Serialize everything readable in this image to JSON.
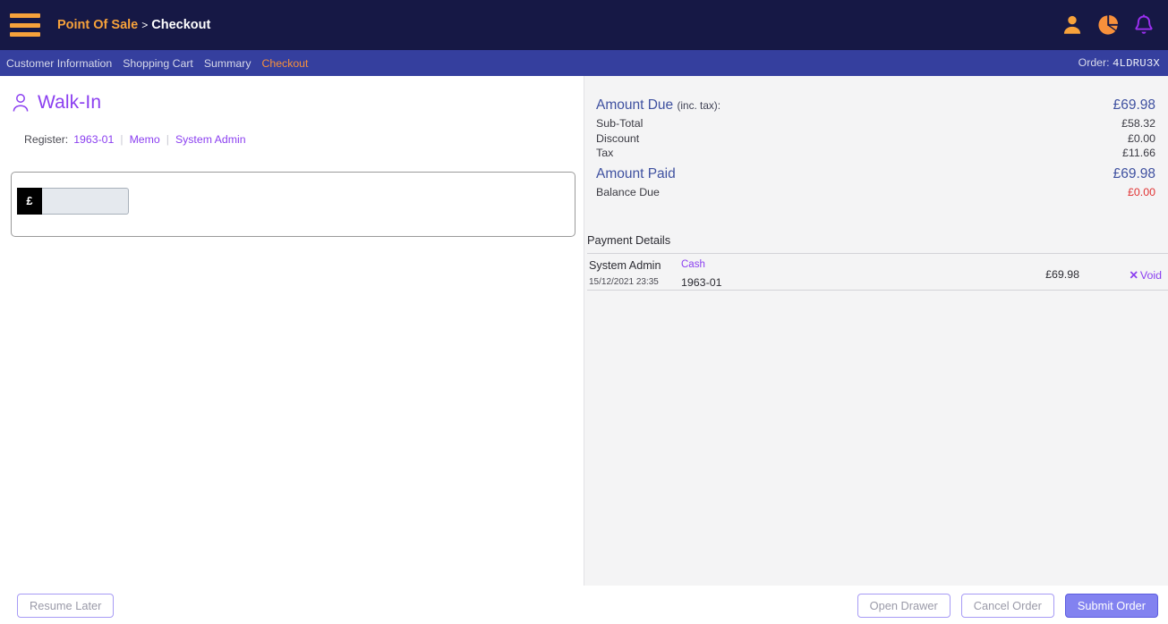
{
  "header": {
    "menu_icon": "hamburger-icon",
    "breadcrumb_root": "Point Of Sale",
    "breadcrumb_separator": ">",
    "breadcrumb_leaf": "Checkout",
    "icons": [
      {
        "name": "user-icon",
        "color": "#f7a23b"
      },
      {
        "name": "pie-chart-icon",
        "color": "#f7903b"
      },
      {
        "name": "bell-icon",
        "color": "#9b2ff0"
      }
    ]
  },
  "tabbar": {
    "tabs": [
      {
        "label": "Customer Information",
        "active": false
      },
      {
        "label": "Shopping Cart",
        "active": false
      },
      {
        "label": "Summary",
        "active": false
      },
      {
        "label": "Checkout",
        "active": true
      }
    ],
    "order_label": "Order:",
    "order_value": "4LDRU3X",
    "active_color": "#f7903b"
  },
  "customer": {
    "icon": "person-icon",
    "name": "Walk-In",
    "register_label": "Register:",
    "register_value": "1963-01",
    "memo_label": "Memo",
    "operator": "System Admin"
  },
  "amount_entry": {
    "currency_prefix": "£",
    "value": "",
    "placeholder": ""
  },
  "totals": {
    "amount_due_label": "Amount Due",
    "amount_due_suffix": "(inc. tax):",
    "amount_due_value": "£69.98",
    "rows": [
      {
        "label": "Sub-Total",
        "value": "£58.32",
        "danger": false
      },
      {
        "label": "Discount",
        "value": "£0.00",
        "danger": false
      },
      {
        "label": "Tax",
        "value": "£11.66",
        "danger": false
      }
    ],
    "amount_paid_label": "Amount Paid",
    "amount_paid_value": "£69.98",
    "balance_due_label": "Balance Due",
    "balance_due_value": "£0.00",
    "balance_due_color": "#e03131"
  },
  "payment_details": {
    "title": "Payment Details",
    "rows": [
      {
        "user": "System Admin",
        "datetime": "15/12/2021 23:35",
        "method": "Cash",
        "register": "1963-01",
        "amount": "£69.98",
        "void_icon": "✕",
        "void_label": "Void"
      }
    ]
  },
  "footer": {
    "resume_later": "Resume Later",
    "open_drawer": "Open Drawer",
    "cancel_order": "Cancel Order",
    "submit_order": "Submit Order",
    "primary_color": "#8282f0"
  }
}
